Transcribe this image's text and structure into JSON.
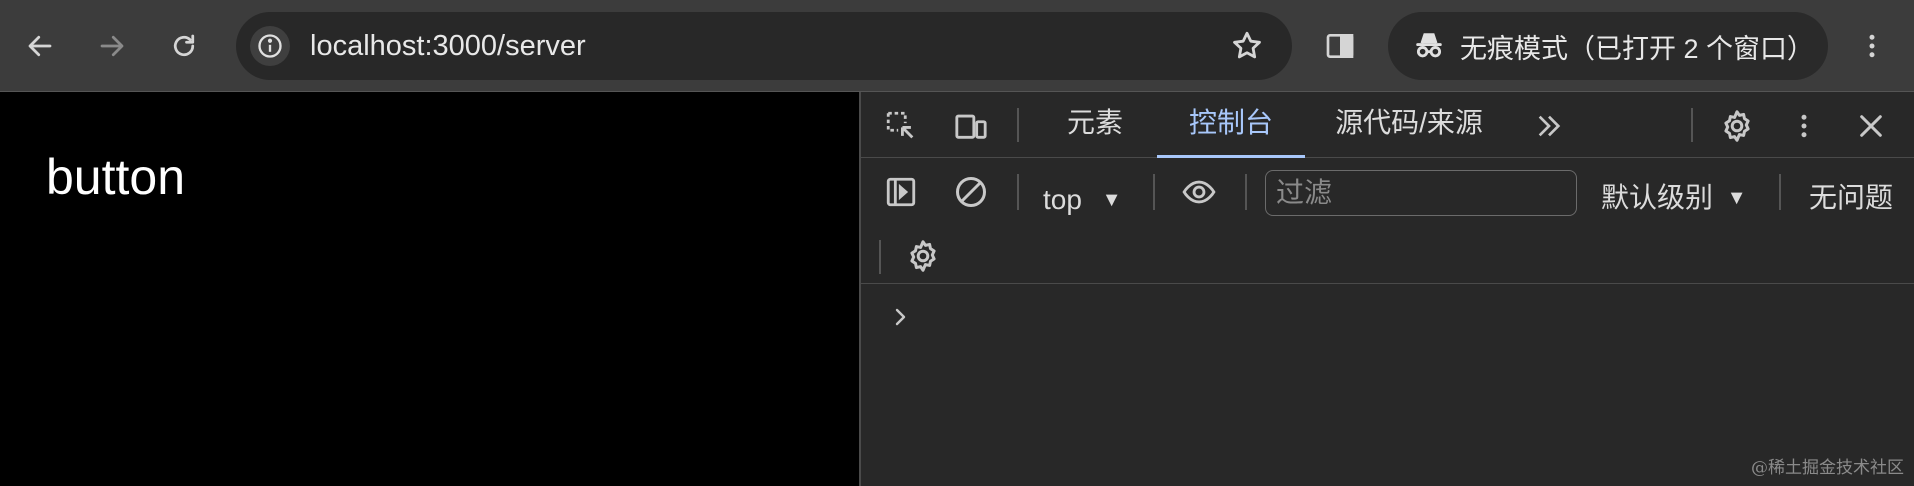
{
  "browser": {
    "url": "localhost:3000/server",
    "incognito_label": "无痕模式（已打开 2 个窗口）",
    "icons": [
      "back-arrow-icon",
      "forward-arrow-icon",
      "reload-icon",
      "site-info-icon",
      "bookmark-star-icon",
      "side-panel-icon",
      "incognito-icon",
      "more-vertical-icon"
    ]
  },
  "page": {
    "button_text": "button"
  },
  "devtools": {
    "tabs": [
      {
        "label": "元素",
        "active": false
      },
      {
        "label": "控制台",
        "active": true
      },
      {
        "label": "源代码/来源",
        "active": false
      }
    ],
    "more_tabs": "»",
    "context": "top",
    "filter_placeholder": "过滤",
    "levels_label": "默认级别",
    "issues_label": "无问题",
    "accent_color": "#a8c7fa"
  },
  "watermark": "@稀土掘金技术社区"
}
